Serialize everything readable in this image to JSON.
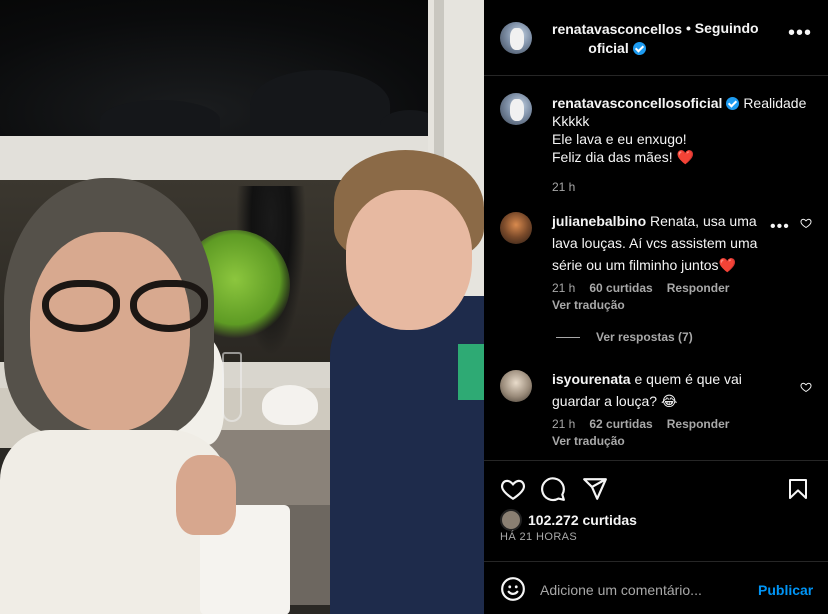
{
  "header": {
    "username": "renatavasconcellos oficial",
    "follow_label": "• Seguindo",
    "more_icon": "more-horizontal-icon"
  },
  "caption": {
    "username": "renatavasconcellosoficial",
    "lines": [
      "Realidade",
      "Kkkkk",
      "Ele lava e eu enxugo!",
      "Feliz dia das mães!"
    ],
    "emoji": "❤️",
    "time": "21 h"
  },
  "comments": [
    {
      "username": "julianebalbino",
      "text": "Renata, usa uma lava louças. Aí vcs assistem uma série ou um filminho juntos",
      "emoji": "❤️",
      "time": "21 h",
      "likes": "60 curtidas",
      "reply_label": "Responder",
      "translate_label": "Ver tradução",
      "view_replies": "Ver respostas (7)"
    },
    {
      "username": "isyourenata",
      "text": "e quem é que vai guardar a louça?",
      "emoji": "😂",
      "time": "21 h",
      "likes": "62 curtidas",
      "reply_label": "Responder",
      "translate_label": "Ver tradução"
    }
  ],
  "post": {
    "likes": "102.272 curtidas",
    "time": "HÁ 21 HORAS"
  },
  "composer": {
    "placeholder": "Adicione um comentário...",
    "post_label": "Publicar"
  },
  "colors": {
    "accent": "#0095f6",
    "verified": "#1d9bf0",
    "secondary_text": "#a8a8a8",
    "heart": "#ed4956"
  }
}
